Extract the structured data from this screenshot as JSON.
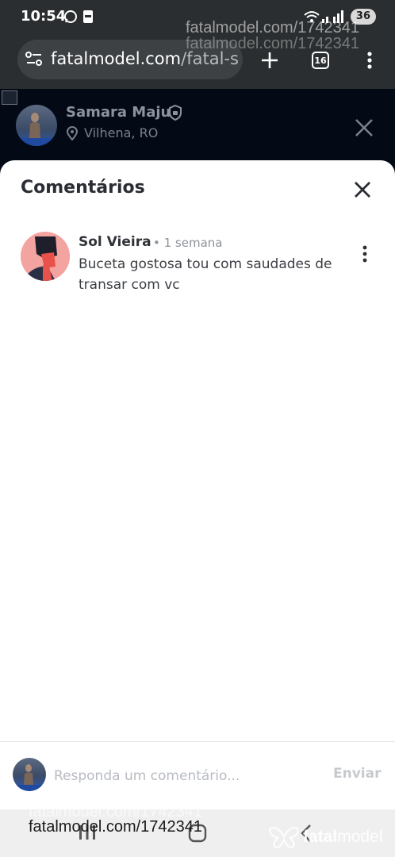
{
  "status_bar": {
    "time": "10:54",
    "battery": "36"
  },
  "browser": {
    "url_host": "fatalmodel.com",
    "url_path": "/fatal-s",
    "tab_count": "16"
  },
  "profile": {
    "name": "Samara Maju",
    "location": "Vilhena, RO"
  },
  "comments_sheet": {
    "title": "Comentários",
    "comments": [
      {
        "author": "Sol Vieira",
        "time": "• 1 semana",
        "text": "Buceta gostosa tou com saudades de transar com vc"
      }
    ]
  },
  "reply": {
    "placeholder": "Responda um comentário...",
    "send_label": "Enviar"
  },
  "watermark": {
    "text": "fatalmodel.com/1742341",
    "brand_fatal": "fatal",
    "brand_model": "model"
  },
  "colors": {
    "accent": "#e8524a",
    "page_dark": "#030a16",
    "browser_chrome": "#2b2e30"
  }
}
